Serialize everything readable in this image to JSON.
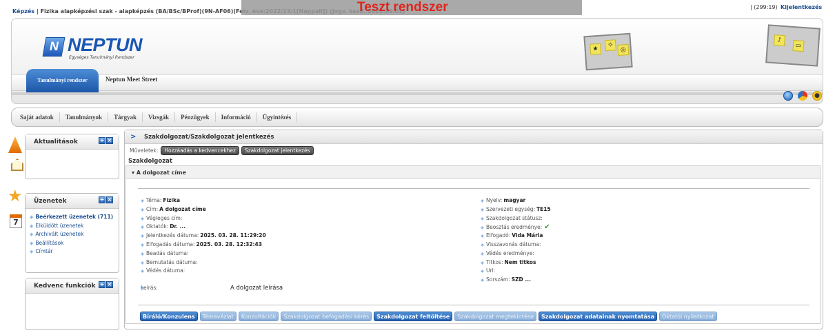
{
  "topbar": {
    "breadcrumb_link": "Képzés",
    "breadcrumb_rest": " | Fizika alapképzési szak - alapképzés (BA/BSc/BProf)(9N-AF06)(Felv. éve:2022/23/1[Nappali]) (Jogv. kezd.:2022.09.01)",
    "test_system": "Teszt rendszer",
    "counter": "| (299:19)",
    "logout": "Kijelentkezés"
  },
  "header": {
    "logo": "NEPTUN",
    "logo_sub": "Egységes Tanulmányi Rendszer",
    "system_tab": "Tanulmányi rendszer",
    "meet_street": "Neptun Meet Street"
  },
  "nav": [
    "Saját adatok",
    "Tanulmányok",
    "Tárgyak",
    "Vizsgák",
    "Pénzügyek",
    "Információ",
    "Ügyintézés"
  ],
  "sidebar": {
    "news_title": "Aktualitások",
    "messages_title": "Üzenetek",
    "messages": [
      "Beérkezett üzenetek (711)",
      "Elküldött üzenetek",
      "Archivált üzenetek",
      "Beállítások",
      "Címtár"
    ],
    "favorites_title": "Kedvenc funkciók",
    "calendar_day": "7"
  },
  "main": {
    "title": "Szakdolgozat/Szakdolgozat jelentkezés",
    "ops_label": "Műveletek:",
    "ops": [
      "Hozzáadás a kedvencekhez",
      "Szakdolgozat jelentkezés"
    ],
    "section": "Szakdolgozat",
    "accordion": "A dolgozat címe",
    "left_fields": [
      {
        "k": "Téma:",
        "v": "Fizika"
      },
      {
        "k": "Cím:",
        "v": "A dolgozat címe"
      },
      {
        "k": "Végleges cím:",
        "v": ""
      },
      {
        "k": "Oktatók:",
        "v": "Dr. ..."
      },
      {
        "k": "Jelentkezés dátuma:",
        "v": "2025. 03. 28. 11:29:20"
      },
      {
        "k": "Elfogadás dátuma:",
        "v": "2025. 03. 28. 12:32:43"
      },
      {
        "k": "Beadás dátuma:",
        "v": ""
      },
      {
        "k": "Bemutatás dátuma:",
        "v": ""
      },
      {
        "k": "Védés dátuma:",
        "v": ""
      }
    ],
    "leiras_label": "Leírás:",
    "leiras_value": "A dolgozat leírása",
    "right_fields": [
      {
        "k": "Nyelv:",
        "v": "magyar"
      },
      {
        "k": "Szervezeti egység:",
        "v": "TE15"
      },
      {
        "k": "Szakdolgozat státusz:",
        "v": ""
      },
      {
        "k": "Beosztás eredménye:",
        "v": ""
      },
      {
        "k": "Elfogadó:",
        "v": "Vida Mária"
      },
      {
        "k": "Visszavonás dátuma:",
        "v": ""
      },
      {
        "k": "Védés eredménye:",
        "v": ""
      },
      {
        "k": "Titkos:",
        "v": "Nem titkos"
      },
      {
        "k": "Url:",
        "v": ""
      },
      {
        "k": "Sorszám:",
        "v": "SZD ..."
      }
    ],
    "check_icon": "checkmark-icon",
    "buttons": [
      {
        "label": "Bíráló/Konzulens",
        "state": "active"
      },
      {
        "label": "Témavázlat",
        "state": "disabled"
      },
      {
        "label": "Konzultációk",
        "state": "disabled"
      },
      {
        "label": "Szakdolgozat befogadási kérés",
        "state": "disabled"
      },
      {
        "label": "Szakdolgozat feltöltése",
        "state": "active"
      },
      {
        "label": "Szakdolgozat megtekintése",
        "state": "disabled"
      },
      {
        "label": "Szakdolgozat adatainak nyomtatása",
        "state": "active"
      },
      {
        "label": "Oktatói nyilatkozat",
        "state": "disabled"
      }
    ]
  },
  "colors": {
    "accent": "#1c58b8",
    "test": "#e0241c",
    "link": "#1a4d8f"
  }
}
